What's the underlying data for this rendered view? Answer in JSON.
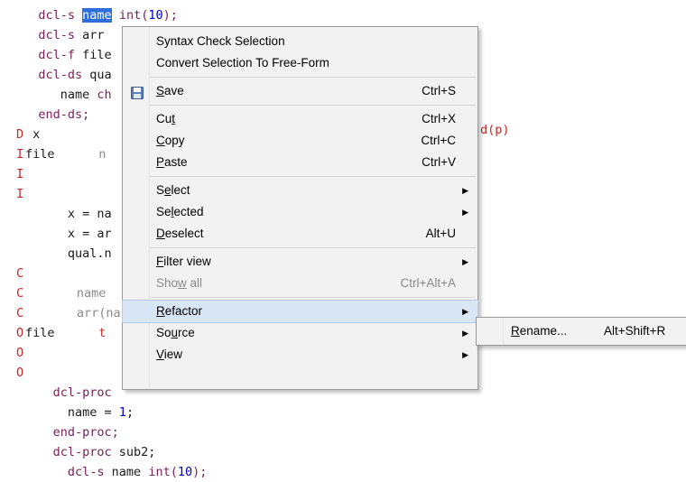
{
  "editor": {
    "lines": [
      {
        "col": "",
        "code": [
          {
            "t": "   "
          },
          {
            "t": "dcl-s",
            "c": "kw"
          },
          {
            "t": " "
          },
          {
            "t": "name",
            "c": "sel"
          },
          {
            "t": " "
          },
          {
            "t": "int(",
            "c": "kw"
          },
          {
            "t": "10",
            "c": "num"
          },
          {
            "t": ");",
            "c": "kw"
          }
        ]
      },
      {
        "col": "",
        "code": [
          {
            "t": "   "
          },
          {
            "t": "dcl-s",
            "c": "kw"
          },
          {
            "t": " arr",
            "c": "id"
          }
        ]
      },
      {
        "col": "",
        "code": [
          {
            "t": "   "
          },
          {
            "t": "dcl-f",
            "c": "kw"
          },
          {
            "t": " file",
            "c": "id"
          }
        ]
      },
      {
        "col": "",
        "code": [
          {
            "t": "   "
          },
          {
            "t": "dcl-ds",
            "c": "kw"
          },
          {
            "t": " qua",
            "c": "id"
          }
        ]
      },
      {
        "col": "",
        "code": [
          {
            "t": "      name ",
            "c": "id"
          },
          {
            "t": "ch",
            "c": "kw"
          }
        ]
      },
      {
        "col": "",
        "code": [
          {
            "t": "   "
          },
          {
            "t": "end-ds;",
            "c": "kw"
          }
        ]
      },
      {
        "col": "D",
        "code": [
          {
            "t": " x",
            "c": "id"
          }
        ]
      },
      {
        "col": "I",
        "code": [
          {
            "t": "file",
            "c": "id"
          },
          {
            "t": "      n",
            "c": "gray"
          }
        ]
      },
      {
        "col": "I",
        "code": []
      },
      {
        "col": "I",
        "code": []
      },
      {
        "col": "",
        "code": [
          {
            "t": "       x = na",
            "c": "id"
          }
        ]
      },
      {
        "col": "",
        "code": [
          {
            "t": "       x = ar",
            "c": "id"
          }
        ]
      },
      {
        "col": "",
        "code": [
          {
            "t": "       qual.n",
            "c": "id"
          }
        ]
      },
      {
        "col": "C",
        "code": []
      },
      {
        "col": "C",
        "code": [
          {
            "t": "       name",
            "c": "gray"
          }
        ]
      },
      {
        "col": "C",
        "code": [
          {
            "t": "       arr(na",
            "c": "gray"
          }
        ]
      },
      {
        "col": "O",
        "code": [
          {
            "t": "file",
            "c": "id"
          },
          {
            "t": "      t",
            "c": "red"
          }
        ]
      },
      {
        "col": "O",
        "code": []
      },
      {
        "col": "O",
        "code": []
      },
      {
        "col": "",
        "code": [
          {
            "t": "     "
          },
          {
            "t": "dcl-proc",
            "c": "kw"
          }
        ]
      },
      {
        "col": "",
        "code": [
          {
            "t": "       name = ",
            "c": "id"
          },
          {
            "t": "1",
            "c": "num"
          },
          {
            "t": ";",
            "c": "id"
          }
        ]
      },
      {
        "col": "",
        "code": [
          {
            "t": "     "
          },
          {
            "t": "end-proc;",
            "c": "kw"
          }
        ]
      },
      {
        "col": "",
        "code": [
          {
            "t": "     "
          },
          {
            "t": "dcl-proc",
            "c": "kw"
          },
          {
            "t": " sub2;",
            "c": "id"
          }
        ]
      },
      {
        "col": "",
        "code": [
          {
            "t": "       "
          },
          {
            "t": "dcl-s",
            "c": "kw"
          },
          {
            "t": " name ",
            "c": "id"
          },
          {
            "t": "int(",
            "c": "kw"
          },
          {
            "t": "10",
            "c": "num"
          },
          {
            "t": ");",
            "c": "kw"
          }
        ]
      }
    ],
    "overflow_fragment": "d(p)"
  },
  "context_menu": {
    "items": [
      {
        "type": "item",
        "name": "syntax-check-selection-item",
        "label": "Syntax Check Selection"
      },
      {
        "type": "item",
        "name": "convert-to-free-form-item",
        "label": "Convert Selection To Free-Form"
      },
      {
        "type": "sep"
      },
      {
        "type": "item",
        "name": "save-item",
        "label": "Save",
        "accel": "S",
        "shortcut": "Ctrl+S",
        "icon": "save-icon"
      },
      {
        "type": "sep"
      },
      {
        "type": "item",
        "name": "cut-item",
        "label": "Cut",
        "accel": "t",
        "shortcut": "Ctrl+X"
      },
      {
        "type": "item",
        "name": "copy-item",
        "label": "Copy",
        "accel": "C",
        "shortcut": "Ctrl+C"
      },
      {
        "type": "item",
        "name": "paste-item",
        "label": "Paste",
        "accel": "P",
        "shortcut": "Ctrl+V"
      },
      {
        "type": "sep"
      },
      {
        "type": "item",
        "name": "select-item",
        "label": "Select",
        "accel": "e",
        "submenu": true
      },
      {
        "type": "item",
        "name": "selected-item",
        "label": "Selected",
        "accel": "l",
        "submenu": true
      },
      {
        "type": "item",
        "name": "deselect-item",
        "label": "Deselect",
        "accel": "D",
        "shortcut": "Alt+U"
      },
      {
        "type": "sep"
      },
      {
        "type": "item",
        "name": "filter-view-item",
        "label": "Filter view",
        "accel": "F",
        "submenu": true
      },
      {
        "type": "item",
        "name": "show-all-item",
        "label": "Show all",
        "accel": "w",
        "shortcut": "Ctrl+Alt+A",
        "disabled": true
      },
      {
        "type": "sep"
      },
      {
        "type": "item",
        "name": "refactor-item",
        "label": "Refactor",
        "accel": "R",
        "submenu": true,
        "highlighted": true
      },
      {
        "type": "item",
        "name": "source-item",
        "label": "Source",
        "accel": "u",
        "submenu": true
      },
      {
        "type": "item",
        "name": "view-item",
        "label": "View",
        "accel": "V",
        "submenu": true
      }
    ]
  },
  "refactor_submenu": {
    "rename_label": "Rename...",
    "rename_accel": "R",
    "rename_shortcut": "Alt+Shift+R"
  },
  "icons": {
    "submenu_arrow": "triangle-right",
    "save": "floppy-disk"
  },
  "colors": {
    "keyword": "#7a1f56",
    "number": "#0000cc",
    "selection": "#2e6fdb",
    "column_marker": "#c62828",
    "highlight": "#d9e6f5"
  }
}
